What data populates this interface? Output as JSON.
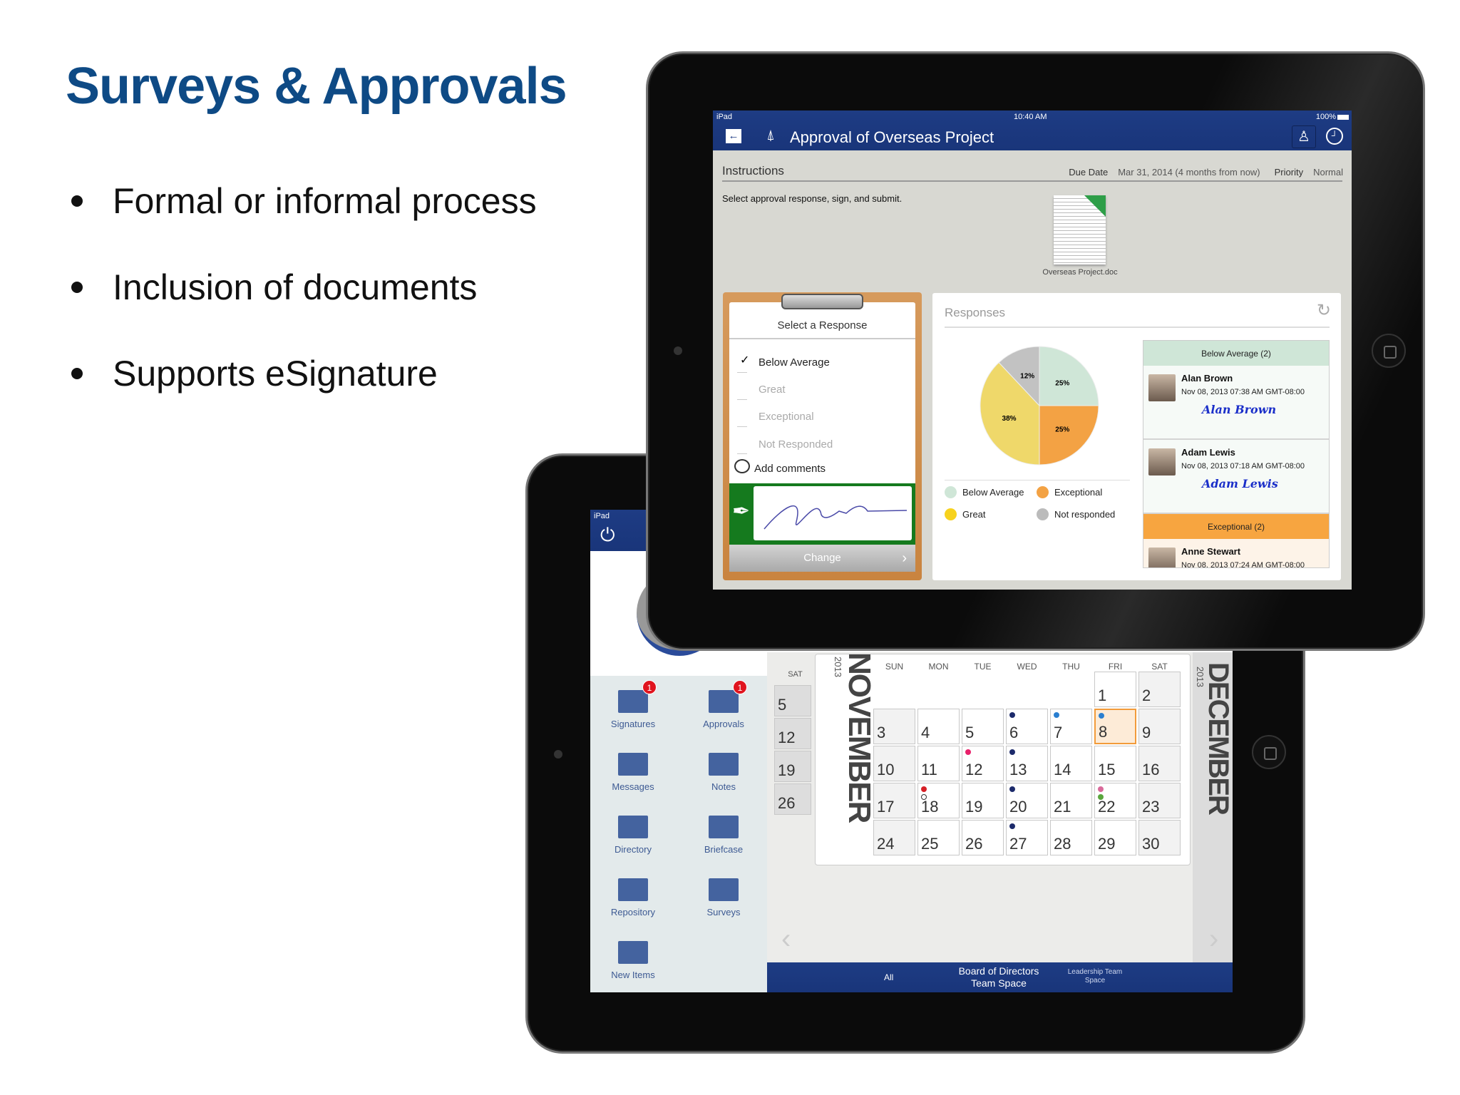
{
  "slide": {
    "title": "Surveys & Approvals",
    "bullets": [
      "Formal or informal process",
      "Inclusion of documents",
      "Supports eSignature"
    ]
  },
  "top_app": {
    "status": {
      "left": "iPad",
      "time": "10:40 AM",
      "battery": "100%"
    },
    "nav": {
      "title": "Approval of Overseas Project",
      "icons": [
        "back-icon",
        "antenna-icon",
        "user-icon",
        "clock-icon"
      ]
    },
    "instructions": {
      "label": "Instructions",
      "due_label": "Due Date",
      "due_value": "Mar 31, 2014 (4 months from now)",
      "priority_label": "Priority",
      "priority_value": "Normal",
      "text": "Select approval response, sign, and submit."
    },
    "document": {
      "name": "Overseas Project.doc"
    },
    "response_card": {
      "title": "Select a Response",
      "options": [
        {
          "label": "Below Average",
          "selected": true
        },
        {
          "label": "Great",
          "selected": false
        },
        {
          "label": "Exceptional",
          "selected": false
        },
        {
          "label": "Not Responded",
          "selected": false
        }
      ],
      "comments": "Add comments",
      "change": "Change"
    },
    "responses": {
      "title": "Responses",
      "chart_data": {
        "type": "pie",
        "slices": [
          {
            "label": "Below Average",
            "value": 25,
            "color": "#cfe6d7"
          },
          {
            "label": "Exceptional",
            "value": 25,
            "color": "#f3a244"
          },
          {
            "label": "Great",
            "value": 38,
            "color": "#efd86a"
          },
          {
            "label": "Not responded",
            "value": 12,
            "color": "#c2c2c2"
          }
        ],
        "data_labels": [
          "25%",
          "25%",
          "38%",
          "12%"
        ]
      },
      "legend": [
        "Below Average",
        "Exceptional",
        "Great",
        "Not responded"
      ],
      "groups": [
        {
          "header": "Below Average (2)",
          "color": "#cfe6d7",
          "people": [
            {
              "name": "Alan Brown",
              "date": "Nov 08, 2013 07:38 AM GMT-08:00",
              "signature": "Alan Brown"
            },
            {
              "name": "Adam Lewis",
              "date": "Nov 08, 2013 07:18 AM GMT-08:00",
              "signature": "Adam Lewis"
            }
          ]
        },
        {
          "header": "Exceptional (2)",
          "color": "#f7a540",
          "people": [
            {
              "name": "Anne Stewart",
              "date": "Nov 08, 2013 07:24 AM GMT-08:00",
              "signature": ""
            }
          ]
        }
      ]
    }
  },
  "bottom_app": {
    "status": {
      "left": "iPad"
    },
    "sidebar": [
      {
        "label": "Signatures",
        "icon": "signature-icon",
        "badge": "1"
      },
      {
        "label": "Approvals",
        "icon": "approval-check-icon",
        "badge": "1"
      },
      {
        "label": "Messages",
        "icon": "messages-icon"
      },
      {
        "label": "Notes",
        "icon": "notes-icon"
      },
      {
        "label": "Directory",
        "icon": "directory-icon"
      },
      {
        "label": "Briefcase",
        "icon": "briefcase-icon"
      },
      {
        "label": "Repository",
        "icon": "folder-icon"
      },
      {
        "label": "Surveys",
        "icon": "surveys-icon"
      },
      {
        "label": "New Items",
        "icon": "new-items-icon"
      }
    ],
    "prev_month": {
      "header": "SAT",
      "days": [
        "5",
        "12",
        "19",
        "26"
      ]
    },
    "calendar": {
      "month": "NOVEMBER",
      "year": "2013",
      "weekdays": [
        "SUN",
        "MON",
        "TUE",
        "WED",
        "THU",
        "FRI",
        "SAT"
      ],
      "first_weekday": 5,
      "days_in_month": 30,
      "today": 8,
      "events": {
        "6": [
          "#1c2a6b"
        ],
        "7": [
          "#2a7fd0"
        ],
        "8": [
          "#2a7fd0"
        ],
        "12": [
          "#e8206a"
        ],
        "13": [
          "#1c2a6b"
        ],
        "18": [
          "#d61f26",
          "hollow"
        ],
        "20": [
          "#1c2a6b"
        ],
        "22": [
          "#d96a9a",
          "#5aa63d"
        ],
        "27": [
          "#1c2a6b"
        ]
      }
    },
    "next_month": {
      "month": "DECEMBER",
      "year": "2013"
    },
    "tabs": [
      {
        "label": "All"
      },
      {
        "label": "Board of Directors Team Space"
      },
      {
        "label": "Leadership Team Space"
      }
    ]
  }
}
